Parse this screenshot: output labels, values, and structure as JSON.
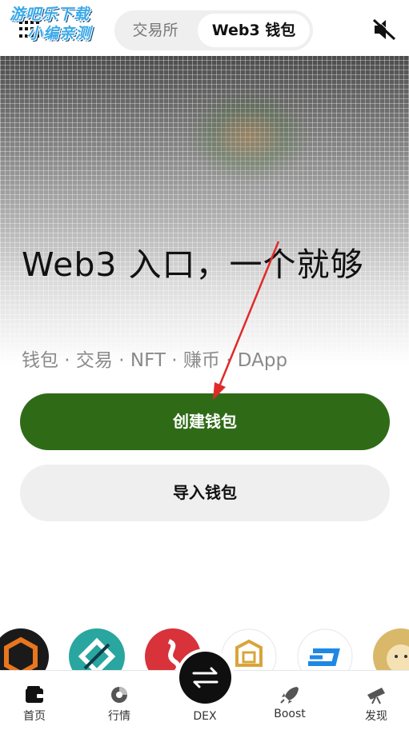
{
  "watermark": {
    "line1": "游吧乐下载",
    "line2": "小编亲测"
  },
  "header": {
    "tabs": [
      {
        "label": "交易所",
        "active": false
      },
      {
        "label": "Web3 钱包",
        "active": true
      }
    ],
    "menu_icon": "grid-dots-icon",
    "sound_icon": "speaker-muted-icon"
  },
  "hero": {
    "headline": "Web3 入口，一个就够",
    "subline": "钱包 · 交易 · NFT · 赚币 · DApp"
  },
  "actions": {
    "create_label": "创建钱包",
    "import_label": "导入钱包"
  },
  "coins": [
    {
      "name": "cube-coin-icon",
      "color": "#e8761f"
    },
    {
      "name": "teal-diamond-coin-icon",
      "color": "#2aa6a0"
    },
    {
      "name": "red-swirl-coin-icon",
      "color": "#d8323a"
    },
    {
      "name": "gold-box-coin-icon",
      "color": "#d9a43a"
    },
    {
      "name": "dash-coin-icon",
      "color": "#1e88e5"
    },
    {
      "name": "doge-coin-icon",
      "color": "#d9b86a"
    }
  ],
  "nav": {
    "items": [
      {
        "label": "首页",
        "icon": "wallet-icon"
      },
      {
        "label": "行情",
        "icon": "chart-icon"
      },
      {
        "label": "DEX",
        "icon": "swap-arrows-icon"
      },
      {
        "label": "Boost",
        "icon": "rocket-icon"
      },
      {
        "label": "发现",
        "icon": "telescope-icon"
      }
    ]
  },
  "colors": {
    "primary": "#2f6b17",
    "annotation_arrow": "#e02a2a"
  }
}
